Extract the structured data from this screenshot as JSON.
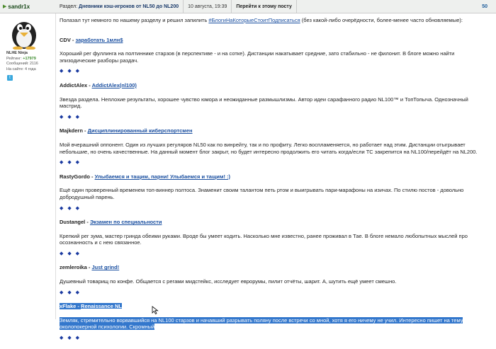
{
  "user": {
    "name": "sandr1x",
    "title": "NLHE Ninja",
    "rating_label": "Рейтинг:",
    "rating_value": "+17979",
    "messages": "Сообщений: 2116",
    "on_site": "На сайте: 4 года"
  },
  "header": {
    "section_label": "Раздел:",
    "section_value": "Дневники кэш-игроков от NL50 до NL200",
    "date": "10 августа, 19:39",
    "goto_post": "Перейти к этому посту",
    "post_number": "50"
  },
  "post": {
    "intro_before_link": "Полазал тут немного по нашему разделу и решил запилить ",
    "intro_link": "#БлогиНаКоторыеСтоитПодписаться",
    "intro_after_link": " (без какой-либо очерёдности, более-менее часто обновляемые):",
    "separator": "◆ ◆ ◆",
    "entries": [
      {
        "author": "CDV",
        "dash": " - ",
        "blog": "заработать 1млн$",
        "text": "Хороший рег фуллинга на полтиннике старзов (в перспективе - и на сотке). Дистанции накатывает средние, зато стабильно - не филонит. В блоге можно найти эпизодические разборы раздач."
      },
      {
        "author": "AddictAlex",
        "dash": " - ",
        "blog": "AddictAlex(nl100)",
        "text": "Звезда раздела. Неплохие результаты, хорошее чувство юмора и неожиданные размышлизмы. Автор идеи сарафанного радио NL100™ и ТопТопыча. Однозначный мастрид."
      },
      {
        "author": "Majkdern",
        "dash": " - ",
        "blog": "Дисциплинированный киберспортсмен",
        "text": "Мой вчерашний оппонент. Один из лучших регуляров NL50 как по винрейту, так и по профиту. Легко воспламеняется, но работает над этим. Дистанции отыгрывает небольшие, но очень качественные. На данный момент блог закрыт, но будет интересно продолжить его читать когда/если ТС закрепится на NL100/перейдёт на NL200."
      },
      {
        "author": "RastyGordo",
        "dash": " - ",
        "blog": "Улыбаемся и тащим, парни! Улыбаемся и тащим! :)",
        "text": "Ещё один проверенный временем топ-виннер полтоса. Знаменит своим талантом петь ртом и выигрывать пари-марафоны на изичах. По стилю постов - довольно добродушный парень."
      },
      {
        "author": "Dustangel",
        "dash": " - ",
        "blog": "Экзамен по специальности",
        "text": "Крепкий рег зума, мастер гринда обеими руками. Вроде бы умеет кодить. Насколько мне известно, ранее проживал в Тае. В блоге немало любопытных мыслей про осознанность и с нею связанное."
      },
      {
        "author": "zemleroika",
        "dash": " - ",
        "blog": "Just grind!",
        "text": "Душевный товарищ по конфе. Общается с регами мидстейкс, исследует еврорумы, пилит отчёты, шарит. А, шутить ещё умеет смешно."
      },
      {
        "author": "xFlake",
        "dash": " - ",
        "blog": "Renaissance NL",
        "text": "Земляк, стремительно ворвавшийся на NL100 старзов и начавший разрывать поляну после встречи со мной, хотя я его ничему не учил. Интересно пишет на тему околопокерной психологии. Скромный"
      }
    ]
  },
  "colors": {
    "highlight": "#3377cc",
    "link": "#1a4fa0",
    "header_bg": "#eef0ee",
    "rating": "#3a8a2a"
  }
}
